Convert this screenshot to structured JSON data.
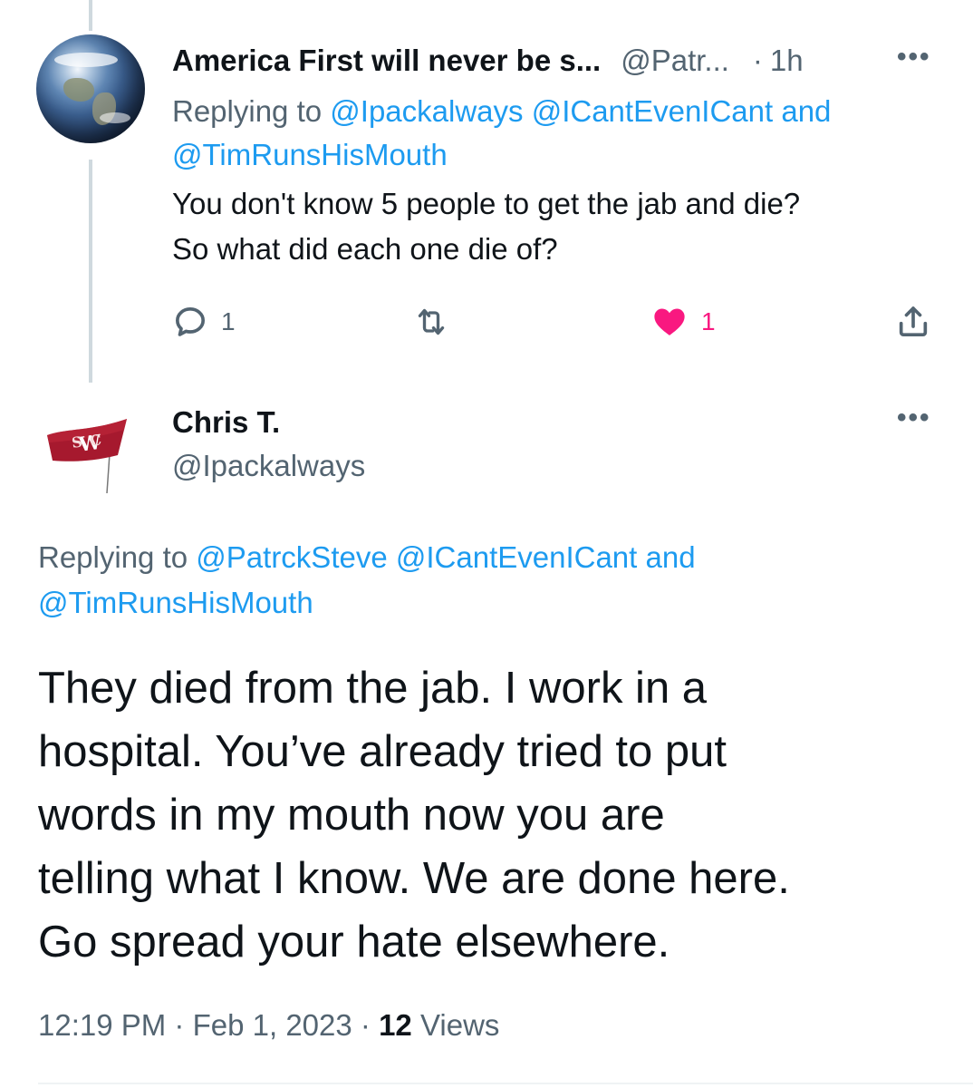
{
  "tweet1": {
    "display_name": "America First will never be s...",
    "handle": "@Patr...",
    "separator": "·",
    "time": "1h",
    "more": "•••",
    "replying_prefix": "Replying to",
    "replying_handles": [
      "@Ipackalways",
      "@ICantEvenICant"
    ],
    "replying_and": "and",
    "replying_last": "@TimRunsHisMouth",
    "text_line1": "You don't know 5 people to get the jab and die?",
    "text_line2": "So what did each one die of?",
    "reply_count": "1",
    "retweet_count": "",
    "like_count": "1",
    "avatar_icon": "earth-globe-avatar"
  },
  "tweet2": {
    "display_name": "Chris T.",
    "handle": "@Ipackalways",
    "more": "•••",
    "replying_prefix": "Replying to",
    "replying_handles": [
      "@PatrckSteve",
      "@ICantEvenICant"
    ],
    "replying_and": "and",
    "replying_last": "@TimRunsHisMouth",
    "text_lines": [
      "They died from the jab. I work in a",
      "hospital. You’ve already tried to put",
      "words in my mouth now you are",
      "telling what I know. We are done here.",
      "Go spread your hate elsewhere."
    ],
    "time": "12:19 PM",
    "separator": "·",
    "date": "Feb 1, 2023",
    "views_count": "12",
    "views_label": "Views",
    "avatar_icon": "wsu-flag-avatar"
  },
  "colors": {
    "link": "#1d9bf0",
    "secondary_text": "#536471",
    "primary_text": "#0f1419",
    "like_active": "#f91880",
    "flag_crimson": "#a6192e"
  }
}
